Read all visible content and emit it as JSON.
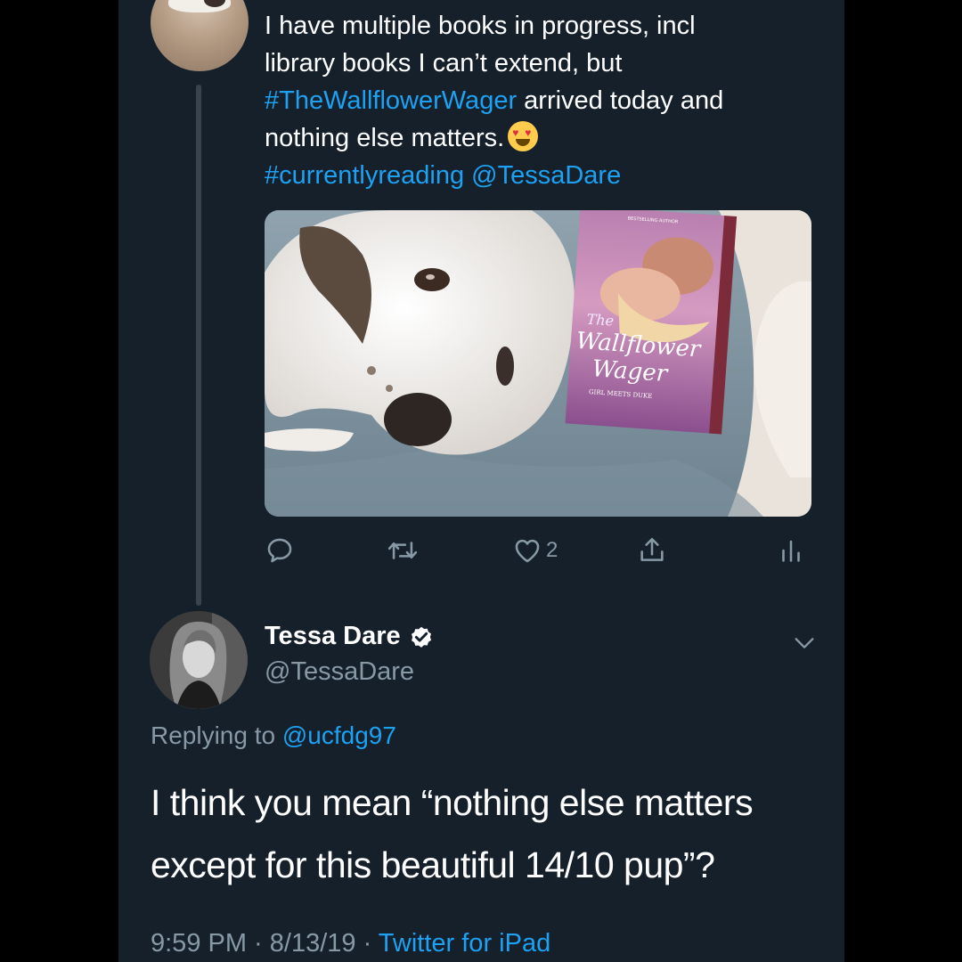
{
  "parent_tweet": {
    "text_line1": "I have multiple books in progress, incl",
    "text_line2": "library books I can’t extend, but",
    "hashtag_book": "#TheWallflowerWager",
    "text_line3_rest": " arrived today and",
    "text_line4": "nothing else matters.",
    "hashtag_reading": "#currentlyreading",
    "mention": "@TessaDare",
    "photo": {
      "book_title_the": "The",
      "book_title_main1": "Wallflower",
      "book_title_main2": "Wager",
      "book_series": "GIRL MEETS DUKE",
      "book_bestselling": "BESTSELLING AUTHOR"
    },
    "actions": {
      "like_count": "2"
    }
  },
  "reply_tweet": {
    "display_name": "Tessa Dare",
    "handle": "@TessaDare",
    "replying_prefix": "Replying to",
    "replying_to": "@ucfdg97",
    "text_line1": "I think you mean “nothing else matters",
    "text_line2": "except for this beautiful 14/10 pup”?",
    "time": "9:59 PM",
    "date": "8/13/19",
    "separator": " · ",
    "source": "Twitter for iPad"
  },
  "icons": {
    "reply": "speech-bubble-icon",
    "retweet": "retweet-icon",
    "like": "heart-icon",
    "share": "share-icon",
    "analytics": "bar-chart-icon",
    "verified": "verified-badge-icon",
    "more": "chevron-down-icon"
  },
  "colors": {
    "background": "#15202b",
    "link": "#1da1f2",
    "secondary_text": "#8899a6",
    "thread_line": "#38444d"
  }
}
